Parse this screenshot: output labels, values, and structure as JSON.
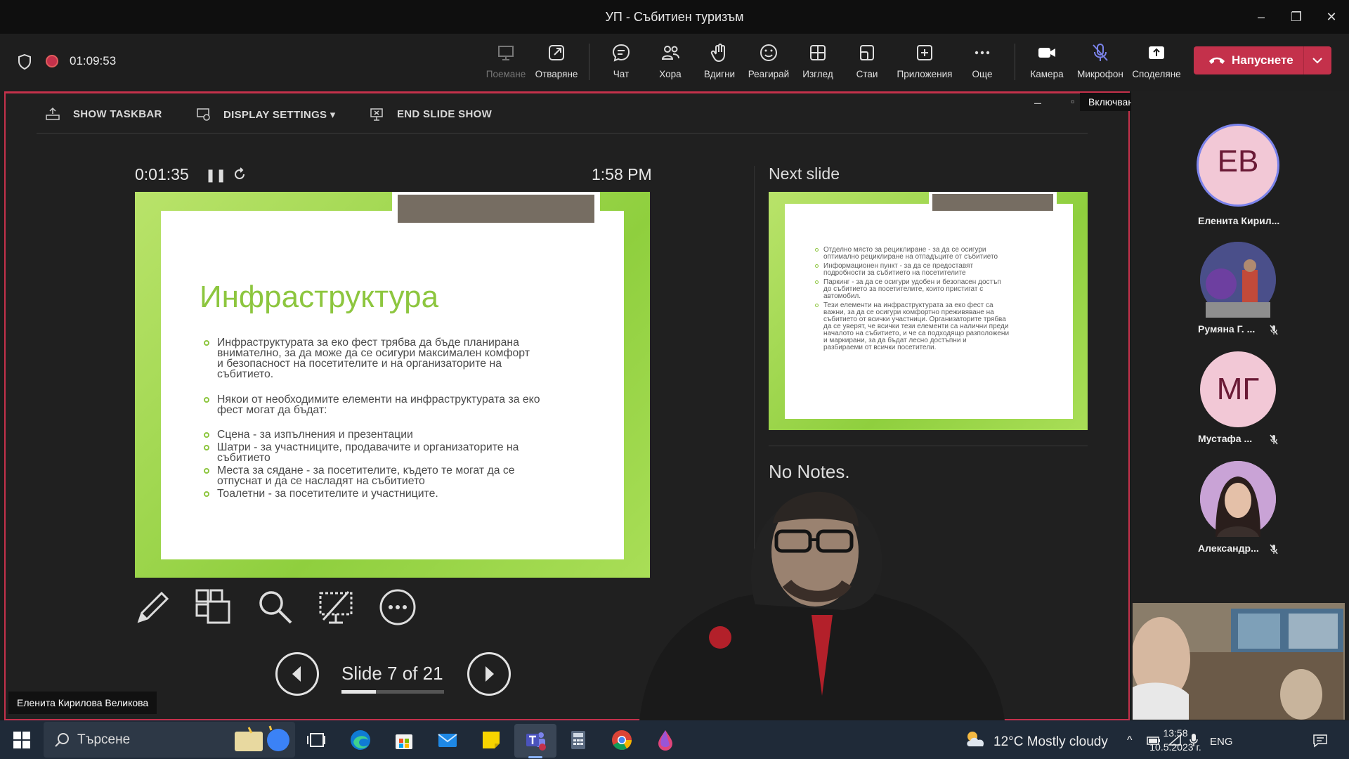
{
  "window": {
    "title": "УП - Събитиен туризъм"
  },
  "meeting": {
    "elapsed": "01:09:53",
    "toolbar": [
      {
        "id": "share-disabled",
        "label": "Поемане",
        "icon": "take-control-icon",
        "dim": true
      },
      {
        "id": "popout",
        "label": "Отваряне",
        "icon": "popout-icon"
      },
      {
        "id": "chat",
        "label": "Чат",
        "icon": "chat-icon"
      },
      {
        "id": "people",
        "label": "Хора",
        "icon": "people-icon"
      },
      {
        "id": "raise",
        "label": "Вдигни",
        "icon": "raise-hand-icon"
      },
      {
        "id": "react",
        "label": "Реагирай",
        "icon": "react-icon"
      },
      {
        "id": "view",
        "label": "Изглед",
        "icon": "view-grid-icon"
      },
      {
        "id": "rooms",
        "label": "Стаи",
        "icon": "rooms-icon"
      },
      {
        "id": "apps",
        "label": "Приложения",
        "icon": "apps-icon"
      },
      {
        "id": "more",
        "label": "Още",
        "icon": "more-icon"
      },
      {
        "id": "camera",
        "label": "Камера",
        "icon": "camera-icon"
      },
      {
        "id": "mic",
        "label": "Микрофон",
        "icon": "mic-muted-icon"
      },
      {
        "id": "share",
        "label": "Споделяне",
        "icon": "share-icon"
      }
    ],
    "leave_label": "Напуснете",
    "tooltip": "Включване на звука (Ctrl+Shift+M)"
  },
  "presenter_view": {
    "show_taskbar": "SHOW TASKBAR",
    "display_settings": "DISPLAY SETTINGS ▾",
    "end_show": "END SLIDE SHOW",
    "timer": "0:01:35",
    "clock": "1:58 PM",
    "next_label": "Next slide",
    "notes": "No Notes.",
    "slide_counter": "Slide 7 of 21",
    "progress_fraction": 0.333,
    "current_slide": {
      "title": "Инфраструктура",
      "bullets": [
        {
          "lines": [
            "Инфраструктурата за еко фест трябва да бъде планирана",
            "внимателно, за да може да се осигури максимален комфорт",
            "и безопасност на посетителите и на организаторите на",
            "събитието."
          ]
        },
        {
          "lines": [
            "Някои от необходимите елементи на инфраструктурата за еко",
            "фест могат да бъдат:"
          ]
        },
        {
          "lines": [
            "Сцена - за изпълнения и презентации"
          ]
        },
        {
          "lines": [
            "Шатри - за участниците, продавачите и организаторите на",
            "събитието"
          ]
        },
        {
          "lines": [
            "Места за сядане - за посетителите, където те могат да се",
            "отпуснат и да се насладят на събитието"
          ]
        },
        {
          "lines": [
            "Тоалетни - за посетителите и участниците."
          ]
        }
      ]
    },
    "next_slide": {
      "bullets": [
        {
          "lines": [
            "Отделно място за рециклиране - за да се осигури",
            "оптимално рециклиране на отпадъците от събитието"
          ]
        },
        {
          "lines": [
            "Информационен пункт - за да се предоставят",
            "подробности за събитието на посетителите"
          ]
        },
        {
          "lines": [
            "Паркинг - за да се осигури удобен и безопасен достъп",
            "до събитието за посетителите, които пристигат с",
            "автомобил."
          ]
        },
        {
          "lines": [
            "Тези елементи на инфраструктурата за еко фест са",
            "важни, за да се осигури комфортно преживяване на",
            "събитието от всички участници. Организаторите трябва",
            "да се уверят, че всички тези елементи са налични преди",
            "началото на събитието, и че са подходящо разположени",
            "и маркирани, за да бъдат лесно достъпни и",
            "разбираеми от всички посетители."
          ]
        }
      ]
    }
  },
  "presenter_name": "Еленита Кирилова Великова",
  "participants": [
    {
      "initials": "ЕВ",
      "name": "Еленита Кирил...",
      "type": "initials",
      "muted": false
    },
    {
      "initials": "",
      "name": "Румяна Г. ...",
      "type": "photo",
      "muted": true
    },
    {
      "initials": "МГ",
      "name": "Мустафа ...",
      "type": "initials",
      "muted": true
    },
    {
      "initials": "",
      "name": "Александр...",
      "type": "photo",
      "muted": true
    }
  ],
  "taskbar": {
    "search_placeholder": "Търсене",
    "weather": "12°C  Mostly cloudy",
    "lang": "ENG",
    "time": "13:58",
    "date": "10.5.2023 г."
  }
}
